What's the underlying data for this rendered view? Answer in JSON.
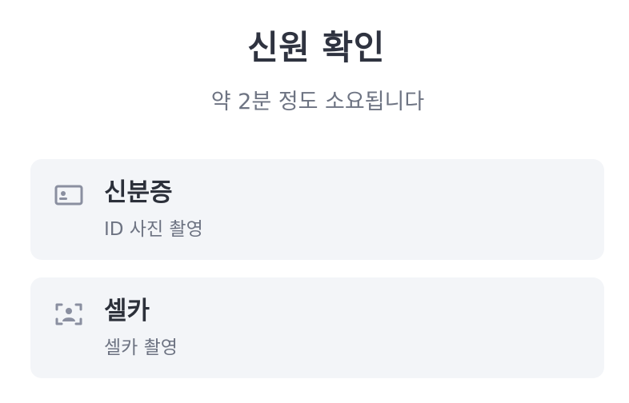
{
  "header": {
    "title": "신원 확인",
    "subtitle": "약 2분 정도 소요됩니다"
  },
  "options": [
    {
      "icon": "id-card-icon",
      "title": "신분증",
      "description": "ID 사진 촬영"
    },
    {
      "icon": "face-scan-icon",
      "title": "셀카",
      "description": "셀카 촬영"
    }
  ],
  "colors": {
    "background": "#ffffff",
    "card_background": "#f3f5f8",
    "title_text": "#2f3340",
    "secondary_text": "#6d7382",
    "icon_color": "#8a8fa0"
  }
}
